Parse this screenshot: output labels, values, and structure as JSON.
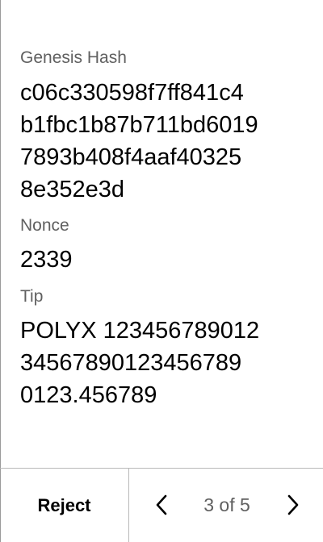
{
  "fields": [
    {
      "label": "Genesis Hash",
      "value_lines": [
        "c06c330598f7ff841c4",
        "b1fbc1b87b711bd6019",
        "7893b408f4aaf40325",
        "8e352e3d"
      ]
    },
    {
      "label": "Nonce",
      "value_lines": [
        "2339"
      ]
    },
    {
      "label": "Tip",
      "value_lines": [
        "POLYX 123456789012",
        "34567890123456789",
        "0123.456789"
      ]
    }
  ],
  "footer": {
    "reject_label": "Reject",
    "pager_text": "3 of 5",
    "prev_icon": "chevron-left-icon",
    "next_icon": "chevron-right-icon"
  }
}
